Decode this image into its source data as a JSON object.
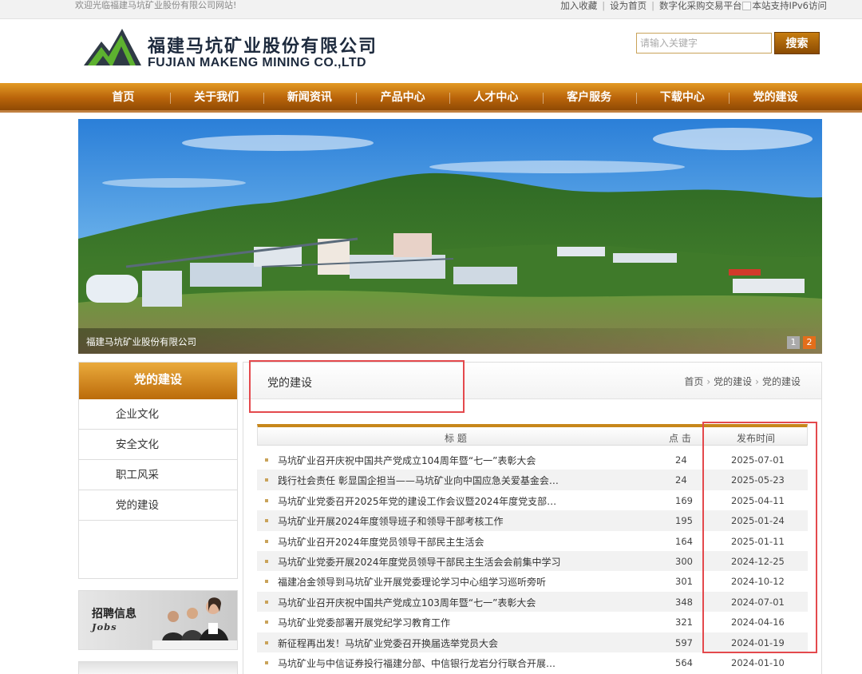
{
  "topbar": {
    "welcome": "欢迎光临福建马坑矿业股份有限公司网站!",
    "links": [
      "加入收藏",
      "设为首页",
      "数字化采购交易平台"
    ],
    "ipv6_text": "本站支持IPv6访问"
  },
  "header": {
    "company_cn": "福建马坑矿业股份有限公司",
    "company_en": "FUJIAN MAKENG MINING CO.,LTD",
    "search_placeholder": "请输入关键字",
    "search_button": "搜索"
  },
  "nav": {
    "items": [
      "首页",
      "关于我们",
      "新闻资讯",
      "产品中心",
      "人才中心",
      "客户服务",
      "下载中心",
      "党的建设"
    ]
  },
  "banner": {
    "caption": "福建马坑矿业股份有限公司",
    "pages": [
      "1",
      "2"
    ],
    "active_page": "2"
  },
  "sidebar": {
    "title": "党的建设",
    "items": [
      "企业文化",
      "安全文化",
      "职工风采",
      "党的建设"
    ],
    "jobs_cn": "招聘信息",
    "jobs_en": "Jobs"
  },
  "main": {
    "title": "党的建设",
    "breadcrumb": [
      "首页",
      "党的建设",
      "党的建设"
    ],
    "columns": {
      "title": "标 题",
      "clicks": "点 击",
      "date": "发布时间"
    },
    "rows": [
      {
        "title": "马坑矿业召开庆祝中国共产党成立104周年暨“七一”表彰大会",
        "clicks": "24",
        "date": "2025-07-01"
      },
      {
        "title": "践行社会责任 彰显国企担当——马坑矿业向中国应急关爱基金会捐…",
        "clicks": "24",
        "date": "2025-05-23"
      },
      {
        "title": "马坑矿业党委召开2025年党的建设工作会议暨2024年度党支部书记抓…",
        "clicks": "169",
        "date": "2025-04-11"
      },
      {
        "title": "马坑矿业开展2024年度领导班子和领导干部考核工作",
        "clicks": "195",
        "date": "2025-01-24"
      },
      {
        "title": "马坑矿业召开2024年度党员领导干部民主生活会",
        "clicks": "164",
        "date": "2025-01-11"
      },
      {
        "title": "马坑矿业党委开展2024年度党员领导干部民主生活会会前集中学习",
        "clicks": "300",
        "date": "2024-12-25"
      },
      {
        "title": "福建冶金领导到马坑矿业开展党委理论学习中心组学习巡听旁听",
        "clicks": "301",
        "date": "2024-10-12"
      },
      {
        "title": "马坑矿业召开庆祝中国共产党成立103周年暨“七一”表彰大会",
        "clicks": "348",
        "date": "2024-07-01"
      },
      {
        "title": "马坑矿业党委部署开展党纪学习教育工作",
        "clicks": "321",
        "date": "2024-04-16"
      },
      {
        "title": "新征程再出发！马坑矿业党委召开换届选举党员大会",
        "clicks": "597",
        "date": "2024-01-19"
      },
      {
        "title": "马坑矿业与中信证券投行福建分部、中信银行龙岩分行联合开展党建…",
        "clicks": "564",
        "date": "2024-01-10"
      }
    ]
  },
  "colors": {
    "accent": "#b9640a",
    "highlight": "#e4494d"
  }
}
